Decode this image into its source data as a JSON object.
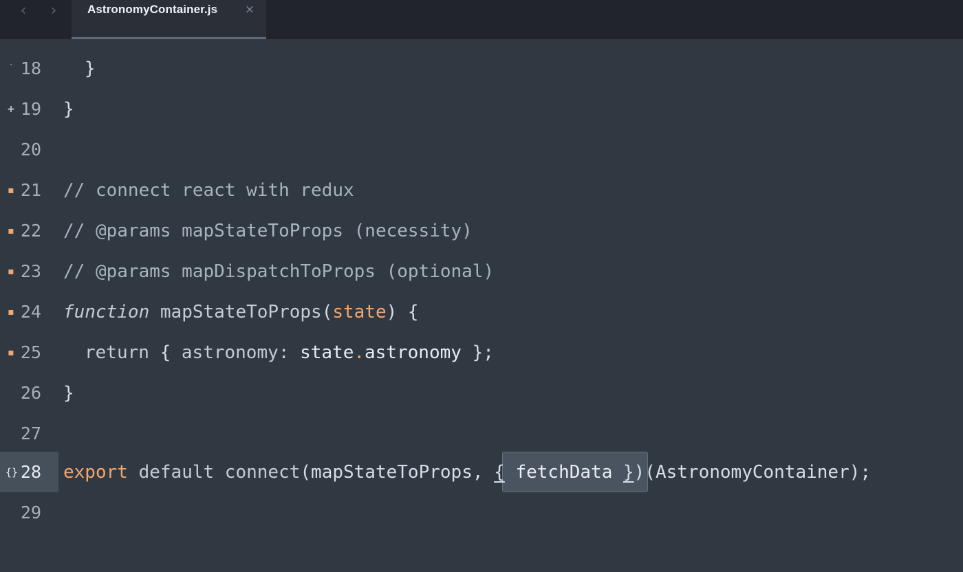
{
  "nav": {
    "back_icon": "‹",
    "forward_icon": "›"
  },
  "tab": {
    "label": "AstronomyContainer.js",
    "close_icon": "×"
  },
  "lines": [
    {
      "number": "18",
      "marker": "˙",
      "code": "  }"
    },
    {
      "number": "19",
      "marker": "+",
      "code": "}"
    },
    {
      "number": "20",
      "marker": "",
      "code": ""
    },
    {
      "number": "21",
      "marker": "▪",
      "code": "// connect react with redux"
    },
    {
      "number": "22",
      "marker": "▪",
      "code": "// @params mapStateToProps (necessity)"
    },
    {
      "number": "23",
      "marker": "▪",
      "code": "// @params mapDispatchToProps (optional)"
    },
    {
      "number": "24",
      "marker": "▪",
      "code": "function mapStateToProps(state) {"
    },
    {
      "number": "25",
      "marker": "▪",
      "code": "  return { astronomy: state.astronomy };"
    },
    {
      "number": "26",
      "marker": "",
      "code": "}"
    },
    {
      "number": "27",
      "marker": "",
      "code": ""
    },
    {
      "number": "28",
      "marker": "{}",
      "code": "export default connect(mapStateToProps, { fetchData })(AstronomyContainer);"
    },
    {
      "number": "29",
      "marker": "",
      "code": ""
    }
  ],
  "tokens": {
    "l18_brace": "}",
    "l19_brace": "}",
    "l21": "// connect react with redux",
    "l22": "// @params mapStateToProps (necessity)",
    "l23": "// @params mapDispatchToProps (optional)",
    "l24_function": "function",
    "l24_name": " mapStateToProps",
    "l24_open": "(",
    "l24_param": "state",
    "l24_close": ") {",
    "l25_return": "return",
    "l25_open": " { ",
    "l25_key": "astronomy:",
    "l25_space": " ",
    "l25_obj": "state",
    "l25_dot": ".",
    "l25_prop": "astronomy",
    "l25_end": " };",
    "l26_brace": "}",
    "l28_export": "export",
    "l28_default": " default",
    "l28_connect": " connect",
    "l28_args": "(mapStateToProps, ",
    "l28_lbrace": "{",
    "l28_fetch": " fetchData ",
    "l28_rbrace": "}",
    "l28_rest": ")(AstronomyContainer);"
  },
  "colors": {
    "editor_bg": "#303841",
    "tabbar_bg": "#21252b",
    "accent_orange": "#f2a671",
    "active_line_gutter": "#46505b"
  }
}
